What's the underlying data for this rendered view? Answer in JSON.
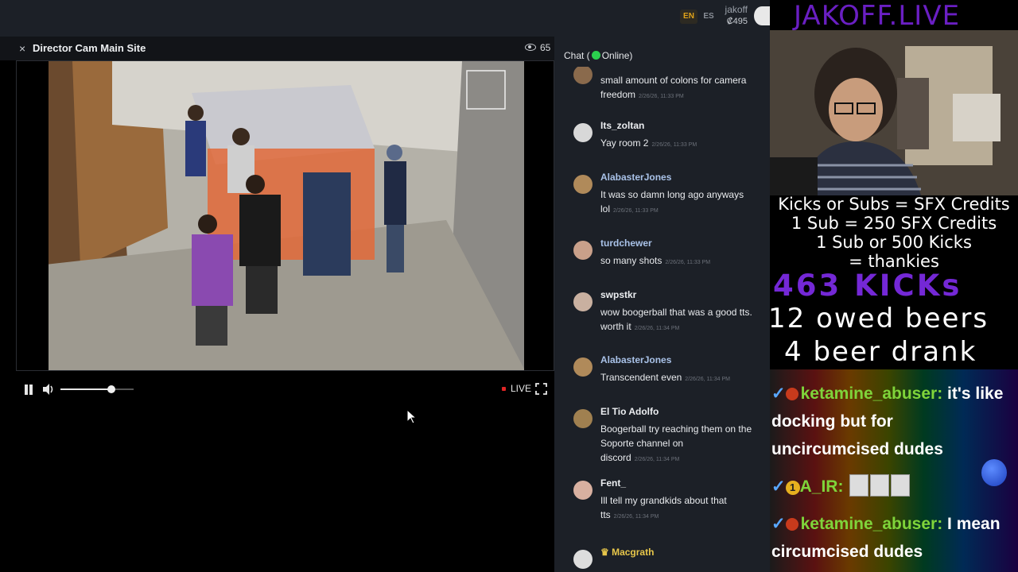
{
  "topbar": {
    "languages": [
      {
        "code": "EN",
        "active": true
      },
      {
        "code": "ES",
        "active": false
      }
    ],
    "username": "jakoff",
    "credits": "₡495"
  },
  "player": {
    "close_symbol": "×",
    "title": "Director Cam Main Site",
    "viewer_count": "65",
    "live_label": "LIVE",
    "volume_level": 0.7
  },
  "chat": {
    "header_prefix": "Chat (",
    "header_status": "Online)",
    "messages": [
      {
        "user": "",
        "text": "small amount of colons for camera freedom",
        "time": "2/26/26, 11:33 PM",
        "style": "normal",
        "avatar": "#8a6a4c"
      },
      {
        "user": "Its_zoltan",
        "text": "Yay room 2",
        "time": "2/26/26, 11:33 PM",
        "style": "normal",
        "avatar": "#d8d8d8"
      },
      {
        "user": "AlabasterJones",
        "text": "It was so damn long ago anyways lol",
        "time": "2/26/26, 11:33 PM",
        "style": "sub",
        "avatar": "#b08a5a"
      },
      {
        "user": "turdchewer",
        "text": "so many shots",
        "time": "2/26/26, 11:33 PM",
        "style": "sub",
        "avatar": "#c9a08a"
      },
      {
        "user": "swpstkr",
        "text": "wow boogerball that was a good tts. worth it",
        "time": "2/26/26, 11:34 PM",
        "style": "normal",
        "avatar": "#c9b0a0"
      },
      {
        "user": "AlabasterJones",
        "text": "Transcendent even",
        "time": "2/26/26, 11:34 PM",
        "style": "sub",
        "avatar": "#b08a5a"
      },
      {
        "user": "El Tio Adolfo",
        "text": "Boogerball try reaching them on the Soporte channel on discord",
        "time": "2/26/26, 11:34 PM",
        "style": "normal",
        "avatar": "#a08050"
      },
      {
        "user": "Fent_",
        "text": "Ill tell my grandkids about that tts",
        "time": "2/26/26, 11:34 PM",
        "style": "normal",
        "avatar": "#d8b0a0"
      },
      {
        "user": "♛ Macgrath",
        "text": "",
        "time": "",
        "style": "gold",
        "avatar": "#dddddd"
      }
    ]
  },
  "stream_overlay": {
    "brand": "JAKOFF.LIVE",
    "info_lines": [
      "Kicks or Subs = SFX Credits",
      "1 Sub = 250 SFX Credits",
      "1 Sub or 500 Kicks",
      "= thankies"
    ],
    "kicks": "463 KICKs",
    "owed_beers": "12 owed beers",
    "beers_drank": "4 beer drank",
    "chat_lines": [
      {
        "user": "ketamine_abuser:",
        "text": " it's like docking but for uncircumcised dudes",
        "badge": "tomato"
      },
      {
        "user": "A_IR:",
        "text": "",
        "badge": "one"
      },
      {
        "user": "ketamine_abuser:",
        "text": " I mean circumcised dudes",
        "badge": "tomato"
      }
    ]
  },
  "colors": {
    "accent": "#e0a31a",
    "online": "#2bd14e",
    "brand_purple": "#6a1fc3",
    "chat_user_green": "#7fd43a",
    "live_red": "#e02525"
  }
}
